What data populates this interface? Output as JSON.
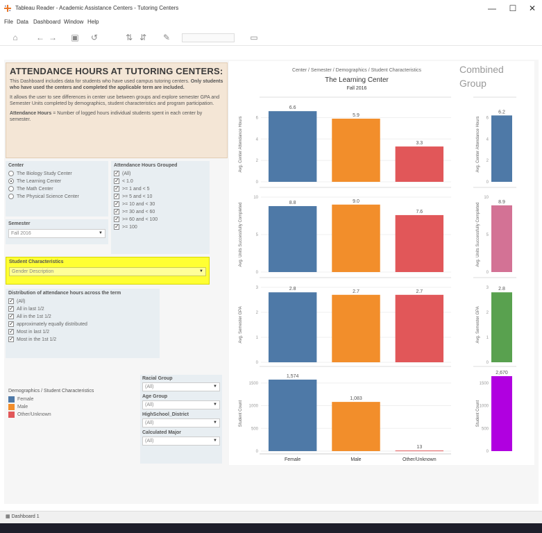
{
  "window": {
    "title": "Tableau Reader - Academic Assistance Centers - Tutoring Centers",
    "minimize": "—",
    "maximize": "☐",
    "close": "✕"
  },
  "menu": [
    "File",
    "Data",
    "Dashboard",
    "Window",
    "Help"
  ],
  "toolbar": {
    "icons": [
      "home-icon",
      "back-icon",
      "forward-icon",
      "save-icon",
      "undo-icon",
      "sort-asc-icon",
      "sort-desc-icon",
      "highlight-icon",
      "presentation-icon"
    ]
  },
  "description": {
    "heading": "ATTENDANCE HOURS AT TUTORING CENTERS:",
    "para1_a": "This Dashboard includes data for students who have used campus tutoring centers.",
    "para1_b": "Only students who have used the centers and completed the applicable term are included.",
    "para2": "It allows the user to see differences in center use between groups and explore semester GPA and Semester Units completed by demographics, student characteristics and program participation.",
    "para3_label": "Attendance Hours",
    "para3_rest": " = Number of logged hours individual students spent in each center by semester."
  },
  "filters": {
    "center": {
      "label": "Center",
      "options": [
        {
          "text": "The Biology Study Center",
          "selected": false
        },
        {
          "text": "The Learning Center",
          "selected": true
        },
        {
          "text": "The Math Center",
          "selected": false
        },
        {
          "text": "The Physical Science Center",
          "selected": false
        }
      ]
    },
    "semester": {
      "label": "Semester",
      "value": "Fall 2016"
    },
    "attendance_hours": {
      "label": "Attendance Hours Grouped",
      "options": [
        "(All)",
        "< 1.0",
        ">= 1 and < 5",
        ">= 5 and < 10",
        ">= 10 and < 30",
        ">= 30 and < 60",
        ">= 60 and < 100",
        ">= 100"
      ]
    },
    "student_characteristics": {
      "label": "Student Characteristics",
      "value": "Gender Description"
    },
    "distribution": {
      "label": "Distribution of attendance hours across the term",
      "options": [
        "(All)",
        "All in last 1/2",
        "All in the 1st 1/2",
        "approximately equally distributed",
        "Most in last 1/2",
        "Most in the 1st 1/2"
      ]
    },
    "racial_group": {
      "label": "Racial Group",
      "value": "(All)"
    },
    "age_group": {
      "label": "Age Group",
      "value": "(All)"
    },
    "highschool_district": {
      "label": "HighSchool_District",
      "value": "(All)"
    },
    "calculated_major": {
      "label": "Calculated Major",
      "value": "(All)"
    }
  },
  "legend": {
    "title": "Demographics / Student Characteristics",
    "items": [
      {
        "label": "Female",
        "color": "#4e79a7"
      },
      {
        "label": "Male",
        "color": "#f28e2b"
      },
      {
        "label": "Other/Unknown",
        "color": "#e15759"
      }
    ]
  },
  "chart_header": {
    "path": "Center / Semester / Demographics / Student Characteristics",
    "center": "The Learning Center",
    "term": "Fall 2016",
    "combined_title": "Combined Group"
  },
  "chart_data": [
    {
      "type": "bar",
      "ylabel": "Avg. Center Attendance Hours",
      "categories": [
        "Female",
        "Male",
        "Other/Unknown"
      ],
      "values": [
        6.6,
        5.9,
        3.3
      ],
      "labels": [
        "6.6",
        "5.9",
        "3.3"
      ],
      "ylim": [
        0,
        7
      ],
      "yticks": [
        0,
        2,
        4,
        6
      ],
      "combined": {
        "value": 6.2,
        "label": "6.2",
        "color": "#4e79a7"
      }
    },
    {
      "type": "bar",
      "ylabel": "Avg. Units Successfully Completed",
      "categories": [
        "Female",
        "Male",
        "Other/Unknown"
      ],
      "values": [
        8.8,
        9.0,
        7.6
      ],
      "labels": [
        "8.8",
        "9.0",
        "7.6"
      ],
      "ylim": [
        0,
        10
      ],
      "yticks": [
        0,
        5,
        10
      ],
      "combined": {
        "value": 8.9,
        "label": "8.9",
        "color": "#d37295"
      }
    },
    {
      "type": "bar",
      "ylabel": "Avg. Semester GPA",
      "categories": [
        "Female",
        "Male",
        "Other/Unknown"
      ],
      "values": [
        2.8,
        2.7,
        2.7
      ],
      "labels": [
        "2.8",
        "2.7",
        "2.7"
      ],
      "ylim": [
        0,
        3
      ],
      "yticks": [
        0,
        1,
        2,
        3
      ],
      "combined": {
        "value": 2.8,
        "label": "2.8",
        "color": "#59a14f"
      }
    },
    {
      "type": "bar",
      "ylabel": "Student Count",
      "categories": [
        "Female",
        "Male",
        "Other/Unknown"
      ],
      "values": [
        1574,
        1083,
        13
      ],
      "labels": [
        "1,574",
        "1,083",
        "13"
      ],
      "ylim": [
        0,
        1650
      ],
      "yticks": [
        0,
        500,
        1000,
        1500
      ],
      "combined": {
        "value": 2670,
        "label": "2,670",
        "color": "#b000e0"
      }
    }
  ],
  "tab": {
    "label": "Dashboard 1"
  }
}
